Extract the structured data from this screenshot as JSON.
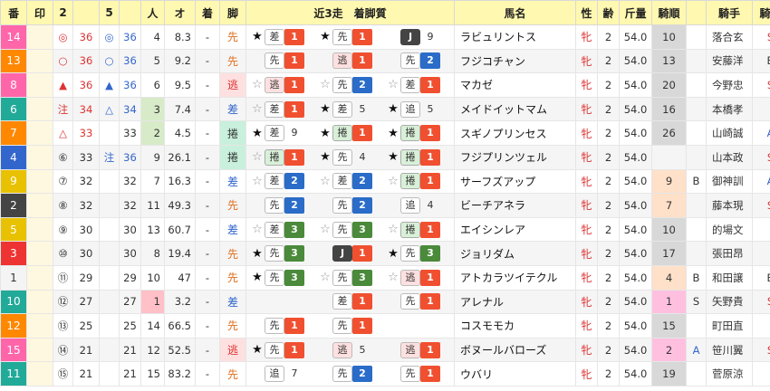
{
  "headers": [
    "番",
    "印",
    "2",
    "",
    "5",
    "",
    "人",
    "オ",
    "着",
    "脚",
    "近3走　着脚質",
    "馬名",
    "性",
    "齢",
    "斤量",
    "騎順",
    "",
    "騎手",
    "騎厩"
  ],
  "rows": [
    {
      "num": "14",
      "mark": "",
      "m2": "◎",
      "v2": "36",
      "m5": "◎",
      "v5": "36",
      "ninki": "4",
      "odds": "8.3",
      "chaku": "-",
      "kyaku": "先",
      "runs": [
        [
          "★",
          "差",
          "1"
        ],
        [
          "★",
          "先",
          "1"
        ],
        [
          "",
          "J",
          "9"
        ]
      ],
      "name": "ラビュリントス",
      "sex": "牝",
      "age": "2",
      "kin": "54.0",
      "kijun": "10",
      "kb": "",
      "jockey": "落合玄",
      "kyu": "S"
    },
    {
      "num": "13",
      "mark": "",
      "m2": "○",
      "v2": "36",
      "m5": "○",
      "v5": "36",
      "ninki": "5",
      "odds": "9.2",
      "chaku": "-",
      "kyaku": "先",
      "runs": [
        [
          "",
          "先",
          "1"
        ],
        [
          "",
          "逃",
          "1"
        ],
        [
          "",
          "先",
          "2"
        ]
      ],
      "name": "フジコチャン",
      "sex": "牝",
      "age": "2",
      "kin": "54.0",
      "kijun": "13",
      "kb": "",
      "jockey": "安藤洋",
      "kyu": "B"
    },
    {
      "num": "8",
      "mark": "",
      "m2": "▲",
      "v2": "36",
      "m5": "▲",
      "v5": "36",
      "ninki": "6",
      "odds": "9.5",
      "chaku": "-",
      "kyaku": "逃",
      "runs": [
        [
          "☆",
          "逃",
          "1"
        ],
        [
          "☆",
          "先",
          "2"
        ],
        [
          "☆",
          "差",
          "1"
        ]
      ],
      "name": "マカゼ",
      "sex": "牝",
      "age": "2",
      "kin": "54.0",
      "kijun": "20",
      "kb": "",
      "jockey": "今野忠",
      "kyu": "S"
    },
    {
      "num": "6",
      "mark": "",
      "m2": "注",
      "v2": "34",
      "m5": "△",
      "v5": "34",
      "ninki": "3",
      "odds": "7.4",
      "chaku": "-",
      "kyaku": "差",
      "runs": [
        [
          "☆",
          "差",
          "1"
        ],
        [
          "★",
          "差",
          "5"
        ],
        [
          "★",
          "追",
          "5"
        ]
      ],
      "name": "メイドイットマム",
      "sex": "牝",
      "age": "2",
      "kin": "54.0",
      "kijun": "16",
      "kb": "",
      "jockey": "本橋孝",
      "kyu": ""
    },
    {
      "num": "7",
      "mark": "",
      "m2": "△",
      "v2": "33",
      "m5": "",
      "v5": "33",
      "ninki": "2",
      "odds": "4.5",
      "chaku": "-",
      "kyaku": "捲",
      "runs": [
        [
          "★",
          "差",
          "9"
        ],
        [
          "★",
          "捲",
          "1"
        ],
        [
          "★",
          "捲",
          "1"
        ]
      ],
      "name": "スギノプリンセス",
      "sex": "牝",
      "age": "2",
      "kin": "54.0",
      "kijun": "26",
      "kb": "",
      "jockey": "山崎誠",
      "kyu": "A"
    },
    {
      "num": "4",
      "mark": "",
      "m2": "⑥",
      "v2": "33",
      "m5": "注",
      "v5": "36",
      "ninki": "9",
      "odds": "26.1",
      "chaku": "-",
      "kyaku": "捲",
      "runs": [
        [
          "☆",
          "捲",
          "1"
        ],
        [
          "★",
          "先",
          "4"
        ],
        [
          "★",
          "捲",
          "1"
        ]
      ],
      "name": "フジプリンツェル",
      "sex": "牝",
      "age": "2",
      "kin": "54.0",
      "kijun": "",
      "kb": "",
      "jockey": "山本政",
      "kyu": "S"
    },
    {
      "num": "9",
      "mark": "",
      "m2": "⑦",
      "v2": "32",
      "m5": "",
      "v5": "32",
      "ninki": "7",
      "odds": "16.3",
      "chaku": "-",
      "kyaku": "差",
      "runs": [
        [
          "☆",
          "差",
          "2"
        ],
        [
          "☆",
          "差",
          "2"
        ],
        [
          "☆",
          "捲",
          "1"
        ]
      ],
      "name": "サーフズアップ",
      "sex": "牝",
      "age": "2",
      "kin": "54.0",
      "kijun": "9",
      "kb": "B",
      "jockey": "御神訓",
      "kyu": "A"
    },
    {
      "num": "2",
      "mark": "",
      "m2": "⑧",
      "v2": "32",
      "m5": "",
      "v5": "32",
      "ninki": "11",
      "odds": "49.3",
      "chaku": "-",
      "kyaku": "先",
      "runs": [
        [
          "",
          "先",
          "2"
        ],
        [
          "",
          "先",
          "2"
        ],
        [
          "",
          "追",
          "4"
        ]
      ],
      "name": "ビーチアネラ",
      "sex": "牝",
      "age": "2",
      "kin": "54.0",
      "kijun": "7",
      "kb": "",
      "jockey": "藤本現",
      "kyu": "S"
    },
    {
      "num": "5",
      "mark": "",
      "m2": "⑨",
      "v2": "30",
      "m5": "",
      "v5": "30",
      "ninki": "13",
      "odds": "60.7",
      "chaku": "-",
      "kyaku": "差",
      "runs": [
        [
          "☆",
          "差",
          "3"
        ],
        [
          "☆",
          "先",
          "3"
        ],
        [
          "☆",
          "捲",
          "1"
        ]
      ],
      "name": "エイシンレア",
      "sex": "牝",
      "age": "2",
      "kin": "54.0",
      "kijun": "10",
      "kb": "",
      "jockey": "的場文",
      "kyu": ""
    },
    {
      "num": "3",
      "mark": "",
      "m2": "⑩",
      "v2": "30",
      "m5": "",
      "v5": "30",
      "ninki": "8",
      "odds": "19.4",
      "chaku": "-",
      "kyaku": "先",
      "runs": [
        [
          "★",
          "先",
          "3"
        ],
        [
          "",
          "J",
          "1"
        ],
        [
          "★",
          "先",
          "3"
        ]
      ],
      "name": "ジョリダム",
      "sex": "牝",
      "age": "2",
      "kin": "54.0",
      "kijun": "17",
      "kb": "",
      "jockey": "張田昂",
      "kyu": ""
    },
    {
      "num": "1",
      "mark": "",
      "m2": "⑪",
      "v2": "29",
      "m5": "",
      "v5": "29",
      "ninki": "10",
      "odds": "47",
      "chaku": "-",
      "kyaku": "先",
      "runs": [
        [
          "★",
          "先",
          "3"
        ],
        [
          "☆",
          "先",
          "3"
        ],
        [
          "☆",
          "逃",
          "1"
        ]
      ],
      "name": "アトカラツイテクル",
      "sex": "牝",
      "age": "2",
      "kin": "54.0",
      "kijun": "4",
      "kb": "B",
      "jockey": "和田譲",
      "kyu": "B"
    },
    {
      "num": "10",
      "mark": "",
      "m2": "⑫",
      "v2": "27",
      "m5": "",
      "v5": "27",
      "ninki": "1",
      "odds": "3.2",
      "chaku": "-",
      "kyaku": "差",
      "runs": [
        [
          "",
          "",
          ""
        ],
        [
          "",
          "差",
          "1"
        ],
        [
          "",
          "先",
          "1"
        ]
      ],
      "name": "アレナル",
      "sex": "牝",
      "age": "2",
      "kin": "54.0",
      "kijun": "1",
      "kb": "S",
      "jockey": "矢野貴",
      "kyu": "S"
    },
    {
      "num": "12",
      "mark": "",
      "m2": "⑬",
      "v2": "25",
      "m5": "",
      "v5": "25",
      "ninki": "14",
      "odds": "66.5",
      "chaku": "-",
      "kyaku": "先",
      "runs": [
        [
          "",
          "先",
          "1"
        ],
        [
          "",
          "先",
          "1"
        ],
        [
          "",
          "",
          ""
        ]
      ],
      "name": "コスモモカ",
      "sex": "牝",
      "age": "2",
      "kin": "54.0",
      "kijun": "15",
      "kb": "",
      "jockey": "町田直",
      "kyu": ""
    },
    {
      "num": "15",
      "mark": "",
      "m2": "⑭",
      "v2": "21",
      "m5": "",
      "v5": "21",
      "ninki": "12",
      "odds": "52.5",
      "chaku": "-",
      "kyaku": "逃",
      "runs": [
        [
          "★",
          "先",
          "1"
        ],
        [
          "",
          "逃",
          "5"
        ],
        [
          "",
          "逃",
          "1"
        ]
      ],
      "name": "ボヌールバローズ",
      "sex": "牝",
      "age": "2",
      "kin": "54.0",
      "kijun": "2",
      "kb": "A",
      "jockey": "笹川翼",
      "kyu": "S"
    },
    {
      "num": "11",
      "mark": "",
      "m2": "⑮",
      "v2": "21",
      "m5": "",
      "v5": "21",
      "ninki": "15",
      "odds": "83.2",
      "chaku": "-",
      "kyaku": "先",
      "runs": [
        [
          "",
          "追",
          "7"
        ],
        [
          "",
          "先",
          "2"
        ],
        [
          "",
          "先",
          "1"
        ]
      ],
      "name": "ウバリ",
      "sex": "牝",
      "age": "2",
      "kin": "54.0",
      "kijun": "19",
      "kb": "",
      "jockey": "菅原涼",
      "kyu": ""
    }
  ]
}
